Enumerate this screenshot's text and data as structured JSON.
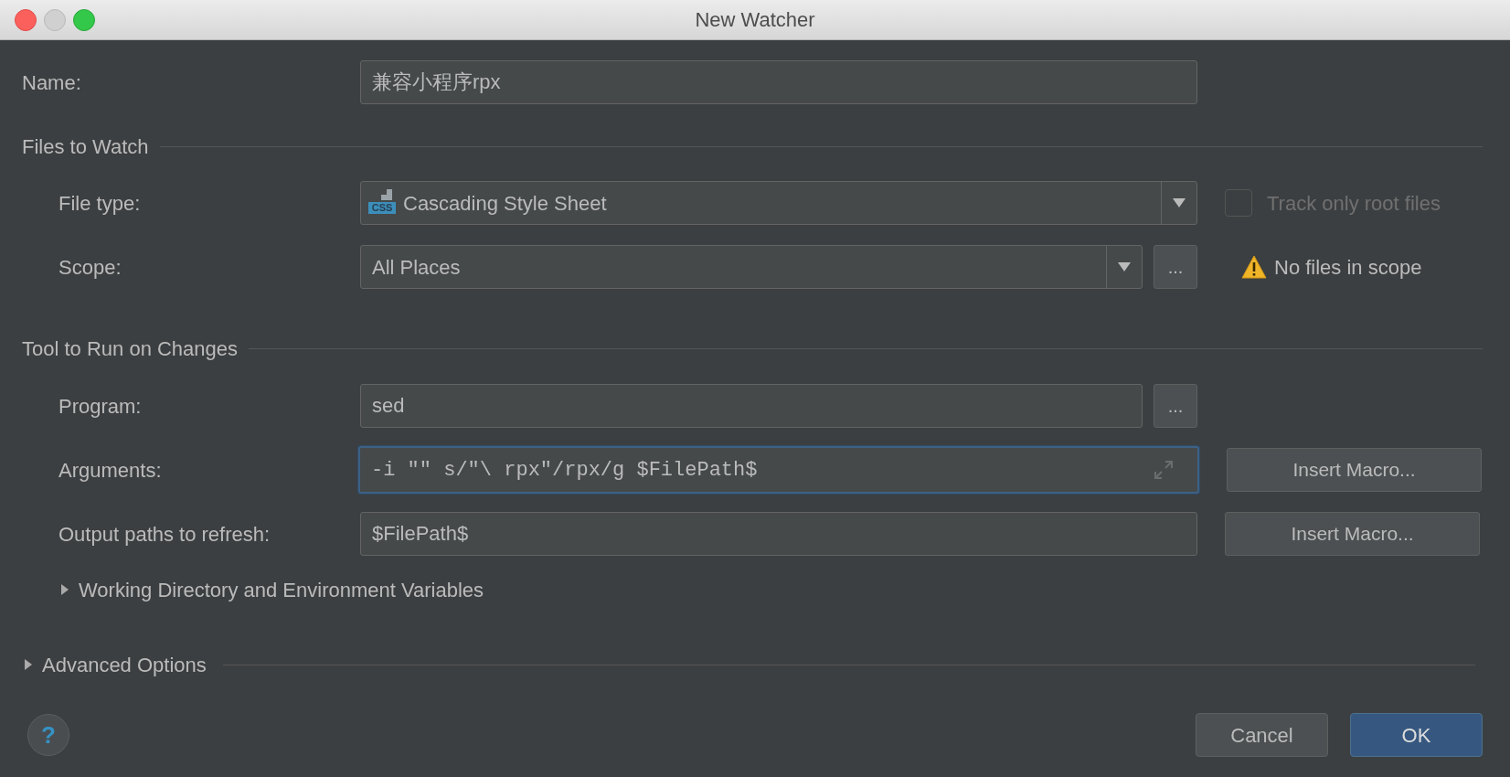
{
  "window": {
    "title": "New Watcher"
  },
  "name": {
    "label": "Name:",
    "value": "兼容小程序rpx"
  },
  "files_to_watch": {
    "heading": "Files to Watch",
    "file_type": {
      "label": "File type:",
      "icon_label": "CSS",
      "value": "Cascading Style Sheet"
    },
    "track_only_root": {
      "label": "Track only root files",
      "checked": false,
      "disabled": true
    },
    "scope": {
      "label": "Scope:",
      "value": "All Places",
      "browse": "...",
      "warning": "No files in scope"
    }
  },
  "tool": {
    "heading": "Tool to Run on Changes",
    "program": {
      "label": "Program:",
      "value": "sed",
      "browse": "..."
    },
    "arguments": {
      "label": "Arguments:",
      "value": "-i \"\" s/\"\\ rpx\"/rpx/g $FilePath$",
      "focused": true,
      "button": "Insert Macro..."
    },
    "output": {
      "label": "Output paths to refresh:",
      "value": "$FilePath$",
      "button": "Insert Macro..."
    },
    "working_dir": {
      "label": "Working Directory and Environment Variables",
      "expanded": false
    }
  },
  "advanced": {
    "label": "Advanced Options",
    "expanded": false
  },
  "help": "?",
  "buttons": [
    {
      "label": "Cancel",
      "kind": "secondary"
    },
    {
      "label": "OK",
      "kind": "default"
    }
  ]
}
